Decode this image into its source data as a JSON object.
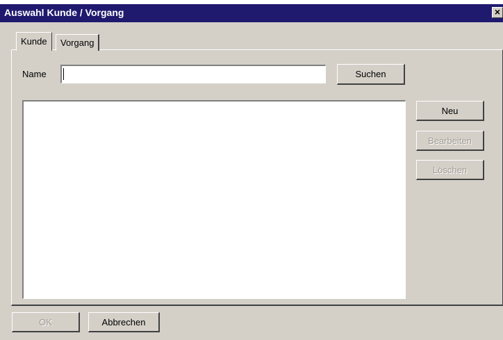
{
  "window": {
    "title": "Auswahl Kunde / Vorgang",
    "close_symbol": "×"
  },
  "tabs": [
    {
      "label": "Kunde",
      "active": true
    },
    {
      "label": "Vorgang",
      "active": false
    }
  ],
  "search": {
    "name_label": "Name",
    "name_value": "",
    "search_button": "Suchen"
  },
  "list": {
    "items": []
  },
  "actions": {
    "new_button": "Neu",
    "edit_button": "Bearbeiten",
    "edit_enabled": false,
    "delete_button": "Löschen",
    "delete_enabled": false
  },
  "footer": {
    "ok_button": "OK",
    "ok_enabled": false,
    "cancel_button": "Abbrechen"
  },
  "colors": {
    "titlebar": "#1f1a6e",
    "face": "#d4d0c8",
    "disabled_text": "#a09c94"
  }
}
